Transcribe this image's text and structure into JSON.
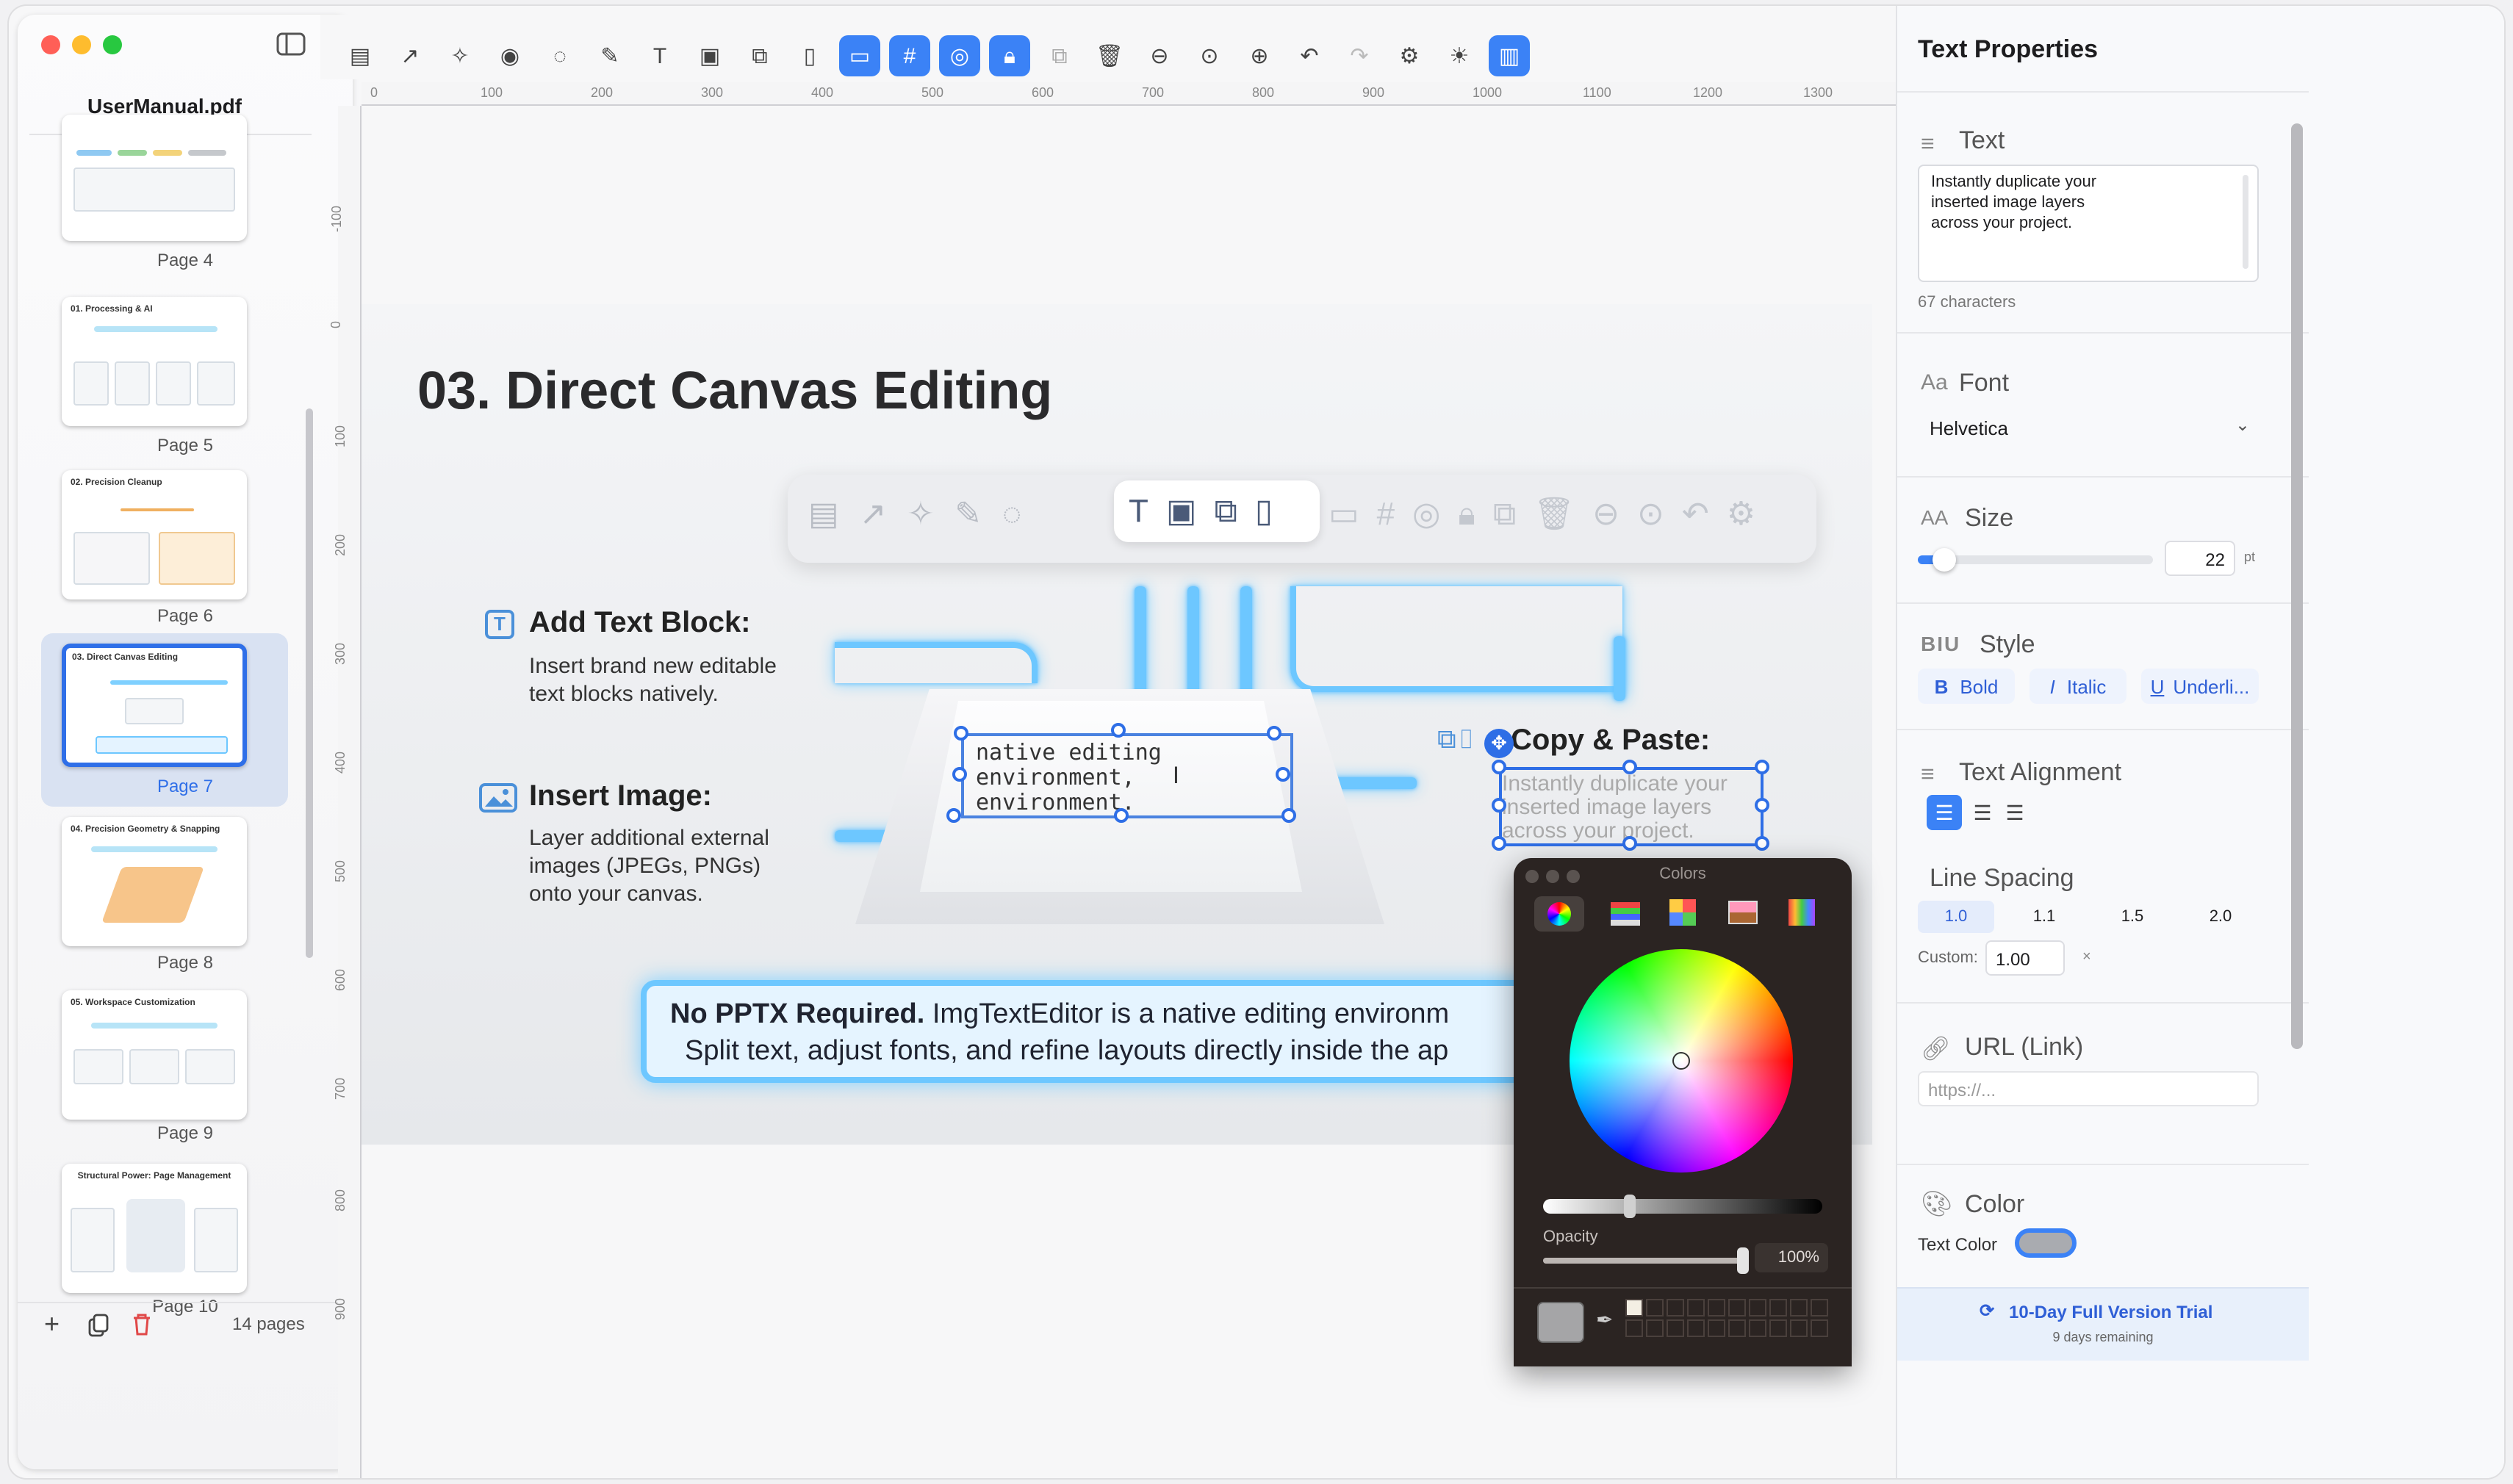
{
  "sidebar": {
    "file_name": "UserManual.pdf",
    "pages": [
      {
        "label": "Page 4",
        "title": ""
      },
      {
        "label": "Page 5",
        "title": "01. Processing & AI"
      },
      {
        "label": "Page 6",
        "title": "02. Precision Cleanup"
      },
      {
        "label": "Page 7",
        "title": "03. Direct Canvas Editing"
      },
      {
        "label": "Page 8",
        "title": "04. Precision Geometry & Snapping"
      },
      {
        "label": "Page 9",
        "title": "05. Workspace Customization"
      },
      {
        "label": "Page 10",
        "title": "Structural Power: Page Management"
      }
    ],
    "page_count": "14 pages"
  },
  "ruler": {
    "top": [
      "0",
      "100",
      "200",
      "300",
      "400",
      "500",
      "600",
      "700",
      "800",
      "900",
      "1000",
      "1100",
      "1200",
      "1300"
    ],
    "left": [
      "-100",
      "0",
      "100",
      "200",
      "300",
      "400",
      "500",
      "600",
      "700",
      "800",
      "900"
    ]
  },
  "slide": {
    "title": "03. Direct Canvas Editing",
    "add_text_heading": "Add Text Block:",
    "add_text_body_1": "Insert brand new editable",
    "add_text_body_2": "text blocks natively.",
    "insert_image_heading": "Insert Image:",
    "insert_image_body_1": "Layer additional external",
    "insert_image_body_2": "images (JPEGs, PNGs)",
    "insert_image_body_3": "onto your canvas.",
    "center_text_1": "native editing",
    "center_text_2": "environment,",
    "center_text_3": "environment.",
    "copy_paste_heading": "Copy & Paste:",
    "selected_text_1": "Instantly duplicate your",
    "selected_text_2": "inserted image layers",
    "selected_text_3": "across your project.",
    "banner_bold": "No PPTX Required.",
    "banner_line_1": "ImgTextEditor is a native editing environm",
    "banner_line_2": "Split text, adjust fonts, and refine layouts directly inside the ap"
  },
  "panel": {
    "title": "Text Properties",
    "text_section": "Text",
    "text_value_1": "Instantly duplicate your",
    "text_value_2": "inserted image layers",
    "text_value_3": "across your project.",
    "char_count": "67 characters",
    "font_section": "Font",
    "font_icon": "Aa",
    "font_value": "Helvetica",
    "size_section": "Size",
    "size_icon": "AA",
    "size_value": "22",
    "size_unit": "pt",
    "size_fraction": 0.09,
    "style_section": "Style",
    "style_icon": "BIU",
    "bold": "Bold",
    "italic": "Italic",
    "underline": "Underli...",
    "bold_icon": "B",
    "italic_icon": "I",
    "underline_icon": "U",
    "alignment_section": "Text Alignment",
    "line_spacing_section": "Line Spacing",
    "spacing_options": [
      "1.0",
      "1.1",
      "1.5",
      "2.0"
    ],
    "custom_label": "Custom:",
    "custom_value": "1.00",
    "custom_suffix": "×",
    "url_section": "URL (Link)",
    "url_placeholder": "https://...",
    "color_section": "Color",
    "text_color_label": "Text Color",
    "text_color": "#a9abb0",
    "trial_label": "10-Day Full Version Trial",
    "trial_remaining": "9 days remaining"
  },
  "colors_panel": {
    "title": "Colors",
    "opacity_label": "Opacity",
    "opacity_value": "100%",
    "opacity_fraction": 1.0,
    "selected_color": "#a5a5a7"
  },
  "theme": {
    "accent": "#3b82f6",
    "glow": "#6dc7ff"
  }
}
